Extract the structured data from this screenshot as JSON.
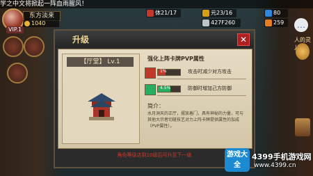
{
  "ticker": "学之中文将掀起一阵血雨腥风！",
  "player": {
    "name": "东方淡来",
    "gold": "1040",
    "vip": "VIP.1"
  },
  "left_labels": [
    "",
    "",
    ""
  ],
  "resources": [
    {
      "icon": "stamina-icon",
      "value": "体21/17",
      "color": "#c0392b"
    },
    {
      "icon": "yuan-icon",
      "value": "元23/16",
      "color": "#d4a017"
    },
    {
      "icon": "gem-icon",
      "value": "80",
      "color": "#2e86de"
    },
    {
      "icon": "silver-icon",
      "value": "427F260",
      "color": "#bdc3c7"
    },
    {
      "icon": "ingot-icon",
      "value": "259",
      "color": "#e67e22"
    }
  ],
  "right": {
    "side_text": "人的灵儿"
  },
  "dialog": {
    "title": "升级",
    "close": "✕",
    "level": "【厅堂】 Lv.1",
    "heading": "强化上阵卡牌PVP属性",
    "stats": [
      {
        "icon": "attack-icon",
        "value": "1%",
        "fill": 0.35,
        "color": "#c0392b",
        "desc": "攻击时减少对方攻击"
      },
      {
        "icon": "defense-icon",
        "value": "4.5%",
        "fill": 0.55,
        "color": "#27ae60",
        "desc": "防御时增加己方防御"
      }
    ],
    "intro_label": "简介：",
    "intro_text": "水月洞天的正厅，摆放着门，具有神秘的力量，可与其他大宗者切磋技艺对力上阵卡牌提供属性的加成（PVP属性）。",
    "footer": "角色等级达到10级后可升至下一级"
  },
  "watermark": {
    "logo": "游戏大全",
    "name": "4399手机游戏网",
    "url": "www.4399.cn"
  }
}
